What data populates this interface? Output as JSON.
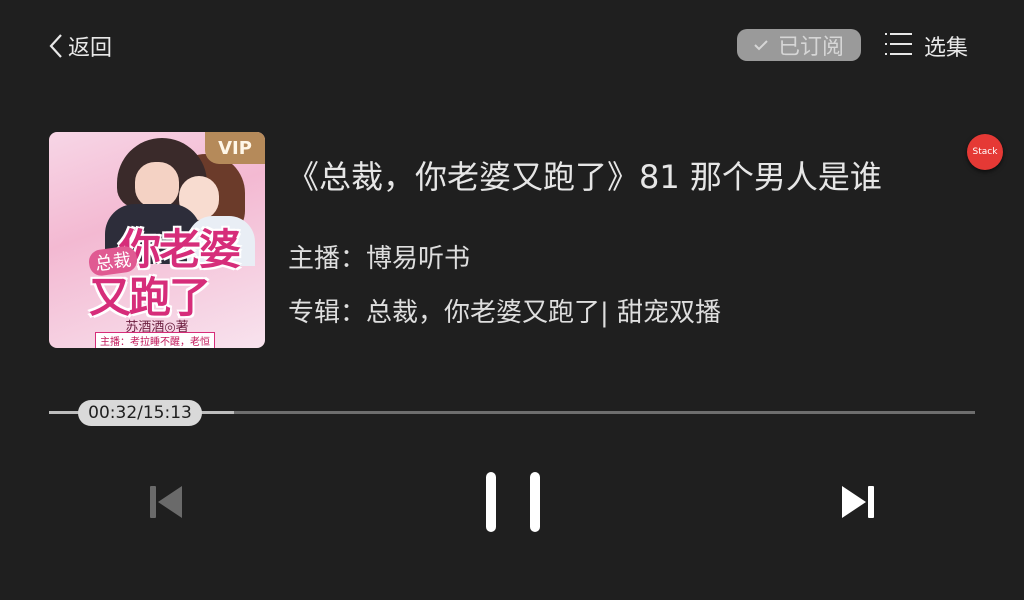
{
  "header": {
    "back_label": "返回",
    "subscribed_label": "已订阅",
    "episodes_label": "选集"
  },
  "cover": {
    "vip_label": "VIP",
    "title_small": "总裁",
    "title_line1": "你老婆",
    "title_line2": "又跑了",
    "author": "苏酒酒◎著",
    "hosts": "主播：考拉睡不醒，老恒"
  },
  "track": {
    "title": "《总裁，你老婆又跑了》81 那个男人是谁",
    "host": "主播：博易听书",
    "album": "专辑：总裁，你老婆又跑了| 甜宠双播"
  },
  "badge": {
    "label": "Stack"
  },
  "progress": {
    "time": "00:32/15:13",
    "elapsed_seconds": 32,
    "total_seconds": 913,
    "played_fraction": 0.2
  },
  "controls": {
    "prev_icon": "skip-previous-icon",
    "pause_icon": "pause-icon",
    "next_icon": "skip-next-icon"
  },
  "colors": {
    "background": "#1f1f1f",
    "badge": "#e53935",
    "vip": "#b58a5a"
  }
}
